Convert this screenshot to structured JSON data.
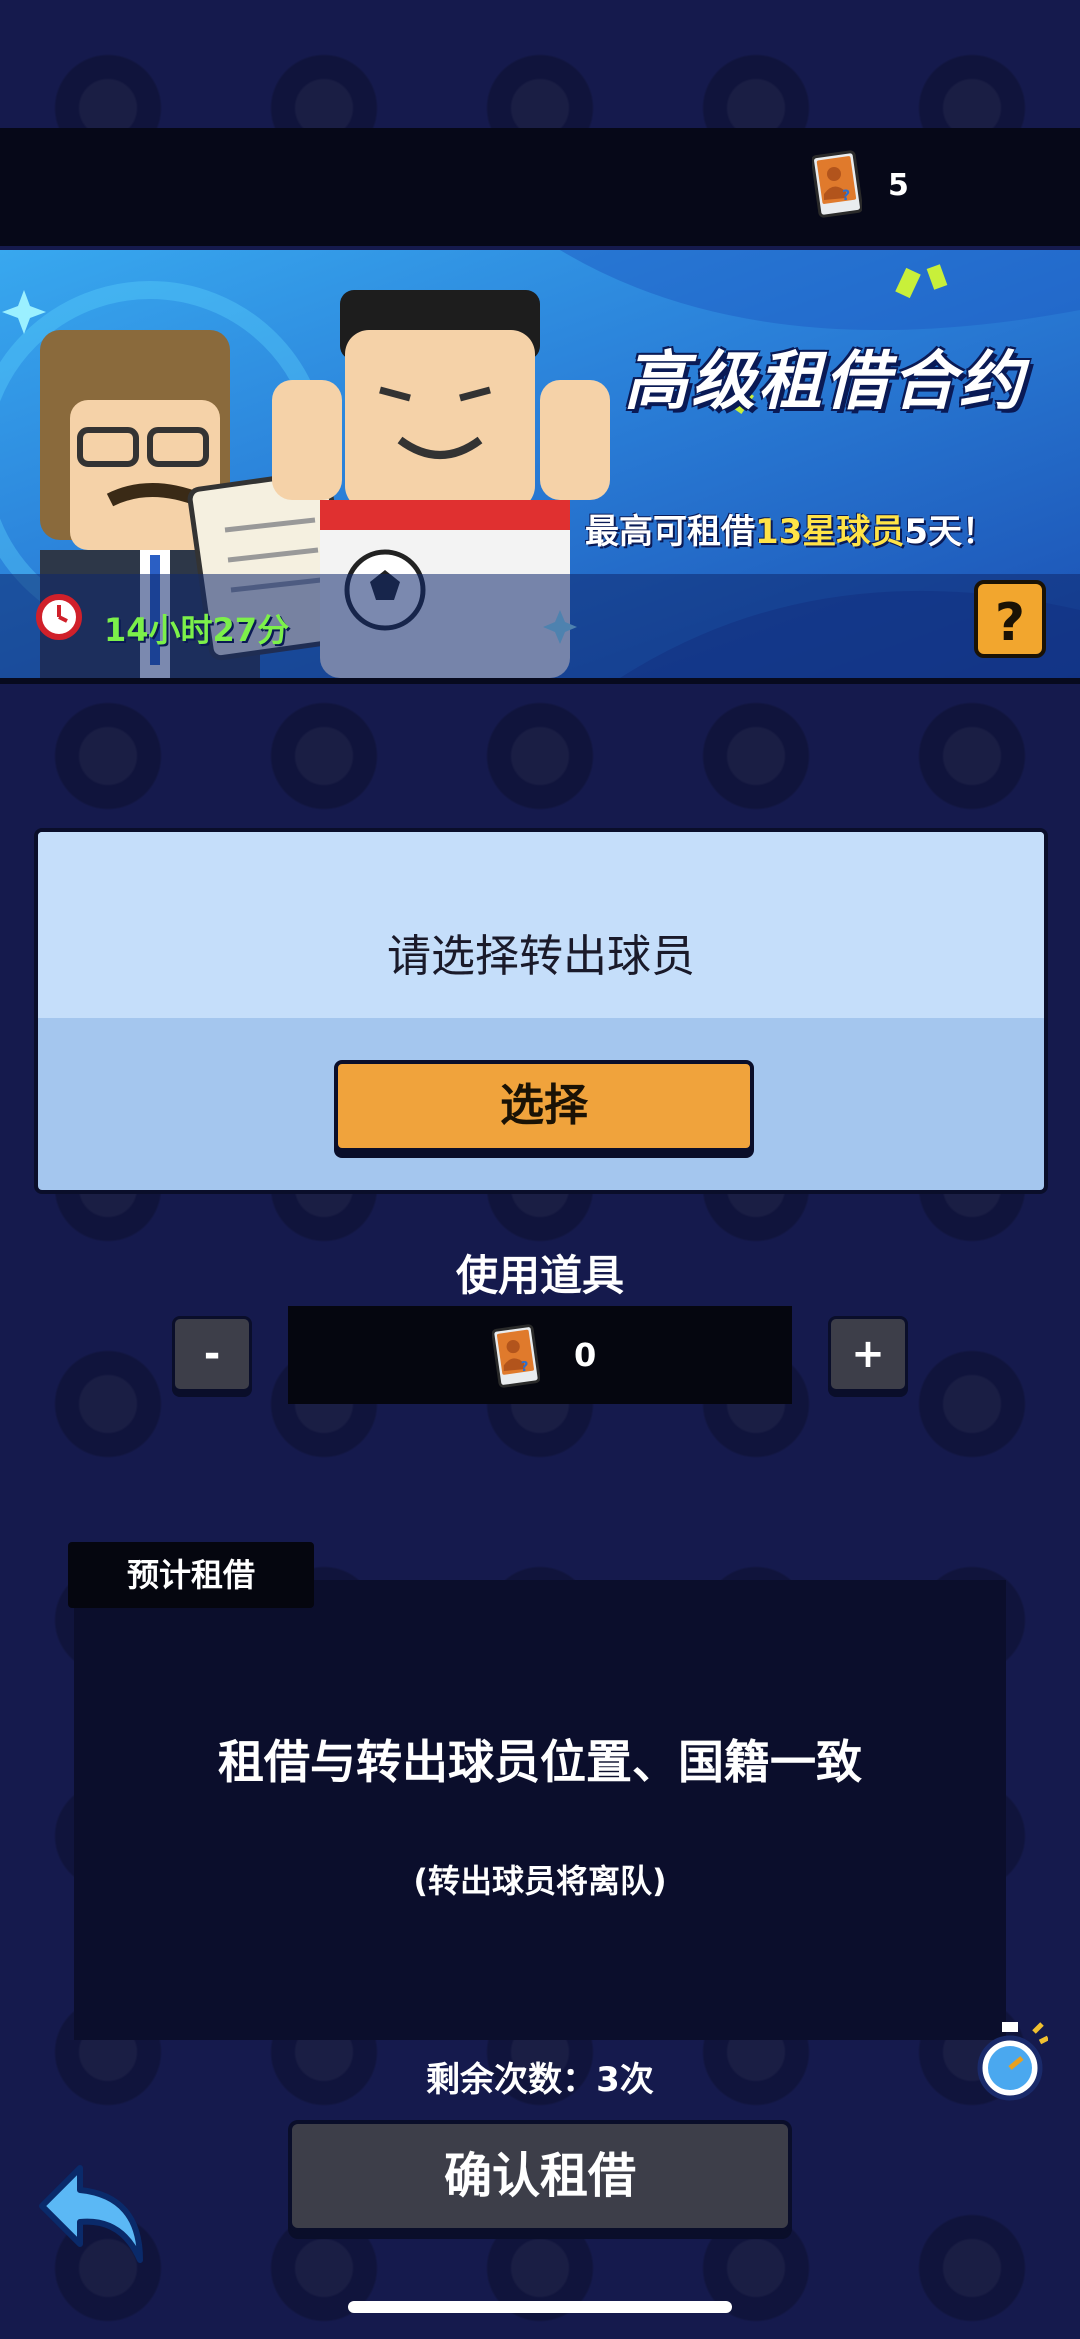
{
  "currency": {
    "count": "5",
    "icon": "player-card-icon"
  },
  "banner": {
    "title": "高级租借合约",
    "subtitle_prefix": "最高可租借",
    "subtitle_highlight": "13星球员",
    "subtitle_suffix": "5天！",
    "timer": "14小时27分",
    "help_label": "?"
  },
  "select_panel": {
    "prompt": "请选择转出球员",
    "button_label": "选择"
  },
  "use_item": {
    "label": "使用道具",
    "minus_label": "-",
    "plus_label": "+",
    "count": "0"
  },
  "estimate": {
    "tab_label": "预计租借",
    "main_text": "租借与转出球员位置、国籍一致",
    "note": "(转出球员将离队)"
  },
  "remaining": "剩余次数：3次",
  "confirm_label": "确认租借",
  "colors": {
    "background": "#151a4d",
    "accent_orange": "#f0a33c",
    "timer_green": "#7cf04a",
    "highlight_yellow": "#ffe347"
  }
}
